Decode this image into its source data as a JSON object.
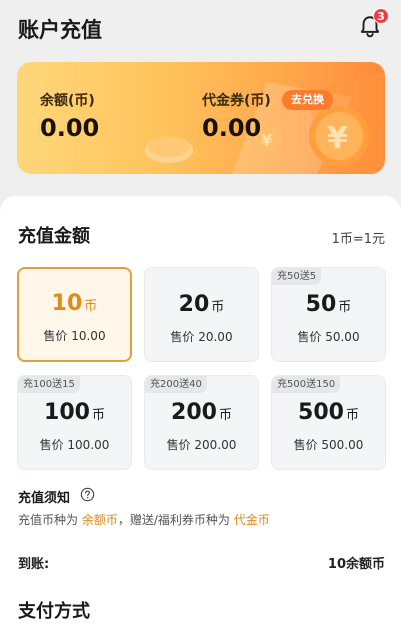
{
  "header": {
    "title": "账户充值",
    "notification_count": "3"
  },
  "balance_card": {
    "balance_label": "余额(币)",
    "balance_value": "0.00",
    "voucher_label": "代金券(币)",
    "voucher_value": "0.00",
    "exchange_label": "去兑换"
  },
  "recharge": {
    "title": "充值金额",
    "rate": "1币=1元",
    "options": [
      {
        "promo": "",
        "amount": "10",
        "unit": "币",
        "price": "售价 10.00",
        "selected": true
      },
      {
        "promo": "",
        "amount": "20",
        "unit": "币",
        "price": "售价 20.00",
        "selected": false
      },
      {
        "promo": "充50送5",
        "amount": "50",
        "unit": "币",
        "price": "售价 50.00",
        "selected": false
      },
      {
        "promo": "充100送15",
        "amount": "100",
        "unit": "币",
        "price": "售价 100.00",
        "selected": false
      },
      {
        "promo": "充200送40",
        "amount": "200",
        "unit": "币",
        "price": "售价 200.00",
        "selected": false
      },
      {
        "promo": "充500送150",
        "amount": "500",
        "unit": "币",
        "price": "售价 500.00",
        "selected": false
      }
    ]
  },
  "notice": {
    "title": "充值须知",
    "text_1": "充值币种为 ",
    "highlight_1": "余额币",
    "text_2": "，赠送/福利券币种为 ",
    "highlight_2": "代金币"
  },
  "arrival": {
    "label": "到账:",
    "value": "10余额币"
  },
  "payment": {
    "title": "支付方式"
  },
  "colors": {
    "accent": "#e08a1c",
    "badge": "#f23b3b",
    "exchange_button": "#ff7a2a"
  }
}
